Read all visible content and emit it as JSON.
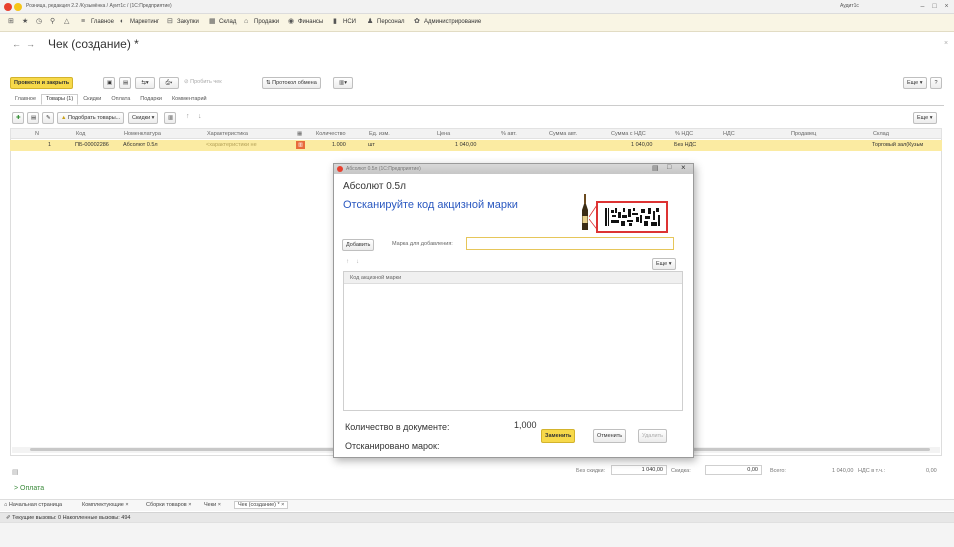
{
  "app": {
    "title": "Розница, редакция 2.2 /Кузьмёнка / Ауит1с / (1С:Предприятие)",
    "user": "Аудит1с"
  },
  "menu": [
    {
      "icon": "grid-icon",
      "label": ""
    },
    {
      "icon": "star-icon",
      "label": ""
    },
    {
      "icon": "clock-icon",
      "label": ""
    },
    {
      "icon": "search-icon",
      "label": ""
    },
    {
      "icon": "bell-icon",
      "label": ""
    },
    {
      "icon": "menu-icon",
      "label": "Главное"
    },
    {
      "icon": "marketing-icon",
      "label": "Маркетинг"
    },
    {
      "icon": "purchases-icon",
      "label": "Закупки"
    },
    {
      "icon": "warehouse-icon",
      "label": "Склад"
    },
    {
      "icon": "sales-icon",
      "label": "Продажи"
    },
    {
      "icon": "finance-icon",
      "label": "Финансы"
    },
    {
      "icon": "nsi-icon",
      "label": "НСИ"
    },
    {
      "icon": "staff-icon",
      "label": "Персонал"
    },
    {
      "icon": "gear-icon",
      "label": "Администрирование"
    }
  ],
  "doc": {
    "title": "Чек (создание) *",
    "more": "Еще",
    "help": "?"
  },
  "toolbar": {
    "post_close": "Провести и закрыть",
    "punch": "Пробить чек",
    "exchange_log": "Протокол обмена"
  },
  "tabs": [
    "Главное",
    "Товары (1)",
    "Скидки",
    "Оплата",
    "Подарки",
    "Комментарий"
  ],
  "goods_toolbar": {
    "pick": "Подобрать товары...",
    "discounts": "Скидки",
    "more": "Еще"
  },
  "grid": {
    "columns": [
      "N",
      "Код",
      "Номенклатура",
      "Характеристика",
      "",
      "Количество",
      "Ед. изм.",
      "Цена",
      "% авт.",
      "Сумма авт.",
      "Сумма с НДС",
      "% НДС",
      "НДС",
      "Продавец",
      "Склад"
    ],
    "row": {
      "n": "1",
      "code": "ПБ-00002286",
      "item": "Абсолют 0.5л",
      "characteristic": "<характеристики не",
      "qty": "1.000",
      "unit": "шт",
      "price": "1 040,00",
      "sum_vat": "1 040,00",
      "vat_rate": "Без НДС",
      "warehouse": "Торговый зал(Кузьм"
    }
  },
  "totals": {
    "no_discount_label": "Без скидки:",
    "no_discount": "1 040,00",
    "discount_label": "Скидка:",
    "discount": "0,00",
    "total_label": "Всего:",
    "total": "1 040,00",
    "vat_label": "НДС в т.ч.:",
    "vat": "0,00"
  },
  "payment_link": "Оплата",
  "task_tabs": [
    "Начальная страница",
    "Комплектующие",
    "Сборки товаров",
    "Чеки",
    "Чек (создание) *"
  ],
  "status": "Текущие вызовы: 0  Накопленные вызовы: 494",
  "dialog": {
    "title": "Абсолют 0.5л (1С:Предприятие)",
    "subtitle": "Абсолют 0.5л",
    "instruction": "Отсканируйте код акцизной марки",
    "add_button": "Добавить",
    "mark_label": "Марка для добавления:",
    "more": "Еще",
    "list_header": "Код акцизной марки",
    "qty_label": "Количество в документе:",
    "qty_value": "1,000",
    "scanned_label": "Отсканировано марок:",
    "btn_replace": "Заменить",
    "btn_cancel": "Отменить",
    "btn_delete": "Удалить"
  },
  "colors": {
    "accent": "#f7d94a",
    "selected_row": "#fbeba2",
    "link": "#2a58c0",
    "menubar": "#f9f5e4"
  }
}
